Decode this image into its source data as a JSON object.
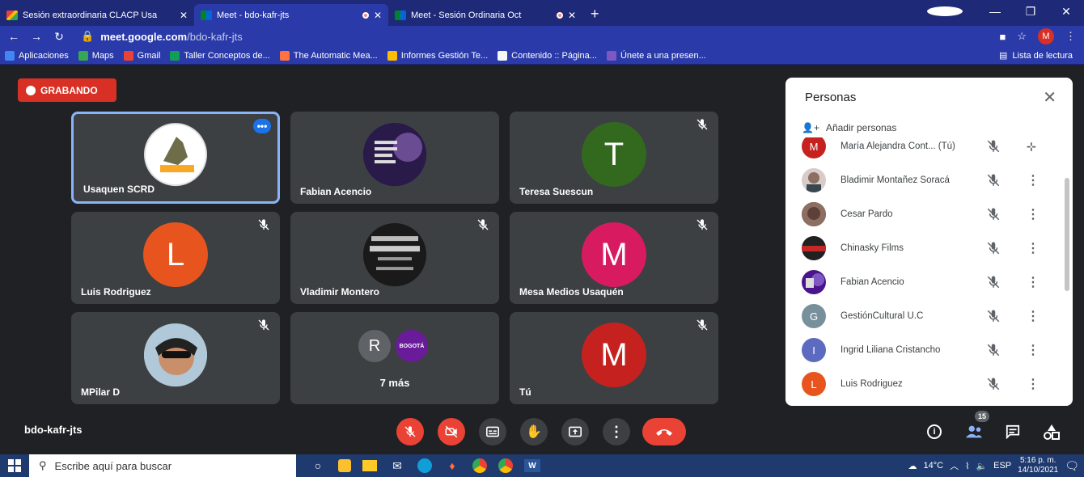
{
  "browser": {
    "tabs": [
      {
        "title": "Sesión extraordinaria CLACP Usa",
        "favicon": "gmail-icon",
        "active": false
      },
      {
        "title": "Meet - bdo-kafr-jts",
        "favicon": "meet-icon",
        "active": true
      },
      {
        "title": "Meet - Sesión Ordinaria Oct",
        "favicon": "meet-icon",
        "active": false
      }
    ],
    "url_host": "meet.google.com",
    "url_path": "/bdo-kafr-jts",
    "profile_initial": "M",
    "bookmarks": [
      "Aplicaciones",
      "Maps",
      "Gmail",
      "Taller Conceptos de...",
      "The Automatic Mea...",
      "Informes Gestión Te...",
      "Contenido :: Página...",
      "Únete a una presen..."
    ],
    "reading_list": "Lista de lectura"
  },
  "meet": {
    "recording_label": "GRABANDO",
    "meeting_code": "bdo-kafr-jts",
    "tiles": [
      {
        "name": "Usaquen SCRD",
        "avatar": "logo",
        "letter": "",
        "color": "",
        "muted": false
      },
      {
        "name": "Fabian Acencio",
        "avatar": "danza-logo",
        "letter": "",
        "color": "",
        "muted": false
      },
      {
        "name": "Teresa Suescun",
        "avatar": "letter",
        "letter": "T",
        "color": "#33691e",
        "muted": true
      },
      {
        "name": "Luis Rodriguez",
        "avatar": "letter",
        "letter": "L",
        "color": "#e8541e",
        "muted": true
      },
      {
        "name": "Vladimir Montero",
        "avatar": "montero-logo",
        "letter": "",
        "color": "",
        "muted": true
      },
      {
        "name": "Mesa Medios Usaquén",
        "avatar": "letter",
        "letter": "M",
        "color": "#d81b60",
        "muted": true
      },
      {
        "name": "MPilar D",
        "avatar": "photo",
        "letter": "",
        "color": "",
        "muted": true
      },
      {
        "name": "",
        "avatar": "group",
        "letter": "R",
        "color": "#5f6368",
        "muted": false
      },
      {
        "name": "Tú",
        "avatar": "letter",
        "letter": "M",
        "color": "#c5221f",
        "muted": true
      }
    ],
    "more_label": "7 más",
    "participant_count": "15"
  },
  "people_panel": {
    "title": "Personas",
    "add_label": "Añadir personas",
    "participants": [
      {
        "name": "María Alejandra Cont...  (Tú)",
        "initial": "M",
        "color": "#c5221f",
        "avatar": "letter"
      },
      {
        "name": "Bladimir Montañez Soracá",
        "initial": "",
        "color": "#8d6e63",
        "avatar": "photo"
      },
      {
        "name": "Cesar Pardo",
        "initial": "",
        "color": "#6d4c41",
        "avatar": "photo"
      },
      {
        "name": "Chinasky Films",
        "initial": "",
        "color": "#212121",
        "avatar": "photo"
      },
      {
        "name": "Fabian Acencio",
        "initial": "",
        "color": "#4a148c",
        "avatar": "photo"
      },
      {
        "name": "GestiónCultural U.C",
        "initial": "G",
        "color": "#78909c",
        "avatar": "letter"
      },
      {
        "name": "Ingrid Liliana Cristancho",
        "initial": "I",
        "color": "#5c6bc0",
        "avatar": "letter"
      },
      {
        "name": "Luis Rodriguez",
        "initial": "L",
        "color": "#e8541e",
        "avatar": "letter"
      }
    ]
  },
  "taskbar": {
    "search_placeholder": "Escribe aquí para buscar",
    "weather": "14°C",
    "language": "ESP",
    "time": "5:16 p. m.",
    "date": "14/10/2021"
  }
}
